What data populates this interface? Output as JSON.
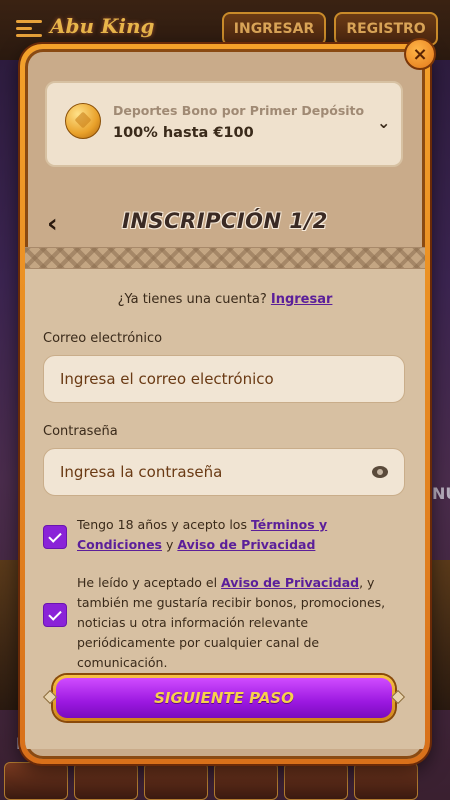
{
  "background": {
    "logo_text": "Abu King",
    "login_label": "INGRESAR",
    "register_label": "REGISTRO",
    "side_text_left": "NU",
    "side_text_right": "NU"
  },
  "modal": {
    "close_symbol": "×",
    "bonus": {
      "subtitle": "Deportes Bono por Primer Depósito",
      "title": "100% hasta €100",
      "chevron": "⌄"
    },
    "back_symbol": "‹",
    "title": "INSCRIPCIÓN 1/2",
    "account_prompt": "¿Ya tienes una cuenta?",
    "login_link": "Ingresar",
    "email": {
      "label": "Correo electrónico",
      "placeholder": "Ingresa el correo electrónico"
    },
    "password": {
      "label": "Contraseña",
      "placeholder": "Ingresa la contraseña"
    },
    "terms": {
      "checked": true,
      "text_before": "Tengo 18 años y acepto los ",
      "terms_link": "Términos y Condiciones",
      "text_middle": " y ",
      "privacy_link": "Aviso de Privacidad"
    },
    "marketing": {
      "checked": true,
      "text_before": "He leído y aceptado el ",
      "privacy_link": "Aviso de Privacidad",
      "text_after": ", y también me gustaría recibir bonos, promociones, noticias u otra información relevante periódicamente por cualquier canal de comunicación."
    },
    "next_button": "SIGUIENTE PASO"
  },
  "colors": {
    "accent_purple": "#8a22d8",
    "frame_orange": "#f4a12a",
    "panel_beige": "#d7c0a2"
  }
}
